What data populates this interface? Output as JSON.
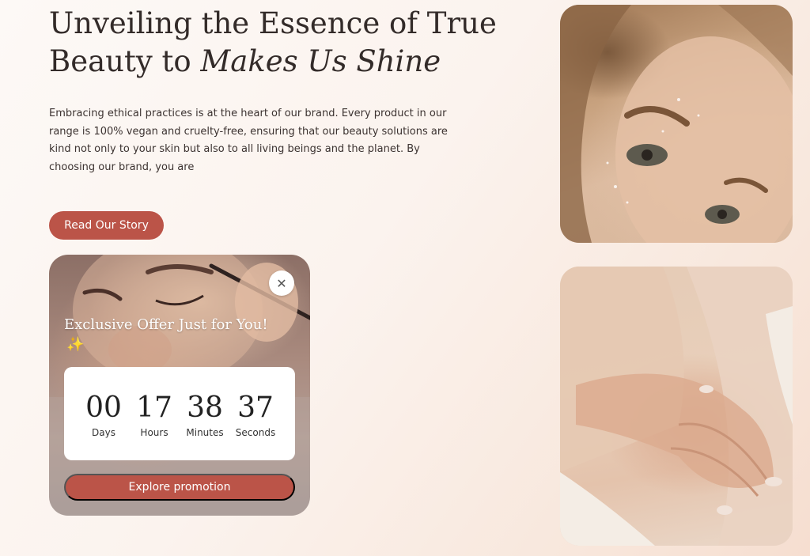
{
  "hero": {
    "title_line1": "Unveiling the Essence of True",
    "title_line2_plain": "Beauty to ",
    "title_line2_italic": "Makes Us Shine",
    "body": "Embracing ethical practices is at the heart of our brand. Every product in our range is 100% vegan and cruelty-free, ensuring that our beauty solutions are kind not only to your skin but also to all living beings and the planet. By choosing our brand, you are",
    "cta_label": "Read Our Story"
  },
  "promo": {
    "title": "Exclusive Offer Just for You!",
    "sparkle_emoji": "✨",
    "close_glyph": "✕",
    "countdown": [
      {
        "value": "00",
        "label": "Days"
      },
      {
        "value": "17",
        "label": "Hours"
      },
      {
        "value": "38",
        "label": "Minutes"
      },
      {
        "value": "37",
        "label": "Seconds"
      }
    ],
    "button_label": "Explore promotion"
  },
  "colors": {
    "accent": "#bb5448",
    "background": "#fbf3ee",
    "text": "#332b29"
  }
}
